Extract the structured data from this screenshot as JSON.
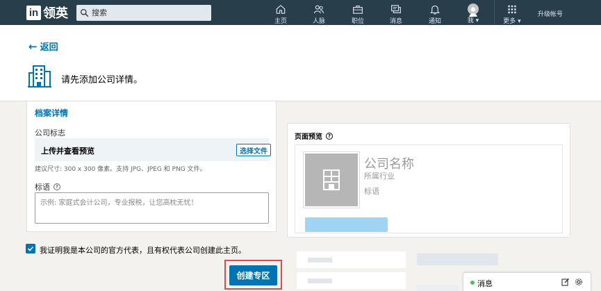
{
  "nav": {
    "logo_badge": "in",
    "logo_text": "领英",
    "search_placeholder": "搜索",
    "items": [
      {
        "label": "主页",
        "icon": "home-icon"
      },
      {
        "label": "人脉",
        "icon": "people-icon"
      },
      {
        "label": "职位",
        "icon": "briefcase-icon"
      },
      {
        "label": "消息",
        "icon": "messages-icon"
      },
      {
        "label": "通知",
        "icon": "bell-icon"
      },
      {
        "label": "我 ▾",
        "icon": "avatar"
      },
      {
        "label": "更多 ▾",
        "icon": "grid-icon"
      }
    ],
    "upgrade": "升级帐号"
  },
  "header": {
    "back_label": "返回",
    "title": "请先添加公司详情。"
  },
  "form": {
    "section_title": "档案详情",
    "logo_label": "公司标志",
    "upload_text": "上传并查看预览",
    "choose_file_button": "选择文件",
    "size_hint": "建议尺寸: 300 x 300 像素。支持 JPG、JPEG 和 PNG 文件。",
    "tagline_label": "标语",
    "tagline_placeholder": "示例: 家庭式会计公司，专业报税，让您高枕无忧！"
  },
  "confirm": {
    "checked": true,
    "label": "我证明我是本公司的官方代表，且有权代表公司创建此主页。"
  },
  "create_button": "创建专区",
  "preview": {
    "title": "页面预览",
    "company_name": "公司名称",
    "industry": "所属行业",
    "tagline": "标语"
  },
  "messaging": {
    "label": "消息"
  },
  "colors": {
    "nav_bg": "#283e4a",
    "primary": "#0073b1",
    "highlight_outline": "#e04a4a",
    "preview_button": "#9fd4f2"
  }
}
